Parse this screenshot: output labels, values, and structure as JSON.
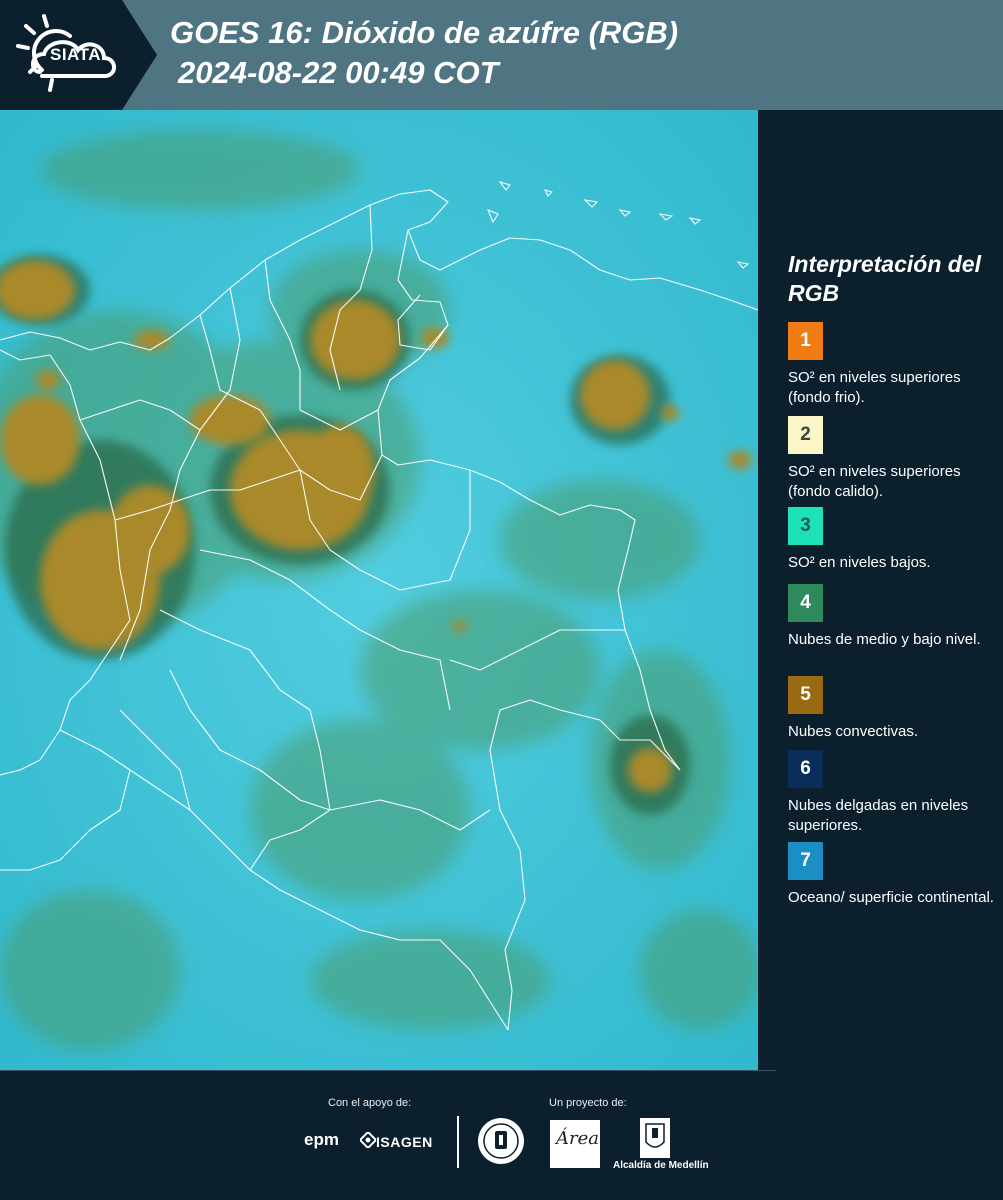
{
  "header": {
    "title": "GOES 16: Dióxido de azúfre (RGB)",
    "timestamp": "2024-08-22 00:49 COT",
    "logo_text": "SIATA"
  },
  "legend": {
    "title": "Interpretación del RGB",
    "items": [
      {
        "number": "1",
        "color": "#f07d14",
        "text_color": "#ffffff",
        "label": "SO² en niveles superiores (fondo frio)."
      },
      {
        "number": "2",
        "color": "#fbf6c8",
        "text_color": "#3a4a40",
        "label": "SO² en niveles superiores (fondo calido)."
      },
      {
        "number": "3",
        "color": "#1de2b8",
        "text_color": "#1d5a5a",
        "label": "SO² en niveles bajos."
      },
      {
        "number": "4",
        "color": "#2e8a5a",
        "text_color": "#ffffff",
        "label": "Nubes de medio y bajo nivel."
      },
      {
        "number": "5",
        "color": "#9a6a12",
        "text_color": "#ffffff",
        "label": "Nubes convectivas."
      },
      {
        "number": "6",
        "color": "#0b2d5c",
        "text_color": "#ffffff",
        "label": "Nubes delgadas en niveles superiores."
      },
      {
        "number": "7",
        "color": "#1b8fc4",
        "text_color": "#ffffff",
        "label": "Oceano/ superficie continental."
      }
    ]
  },
  "footer": {
    "support_caption": "Con el apoyo de:",
    "project_caption": "Un proyecto de:",
    "epm": "epm",
    "isagen": "ISAGEN",
    "area": "Área",
    "alcaldia": "Alcaldía de Medellín"
  },
  "map": {
    "background_color": "#3cc0d6",
    "convective_color": "#a98a2a",
    "low_cloud_color": "#4f9e6e",
    "border_color": "#ffffff"
  }
}
